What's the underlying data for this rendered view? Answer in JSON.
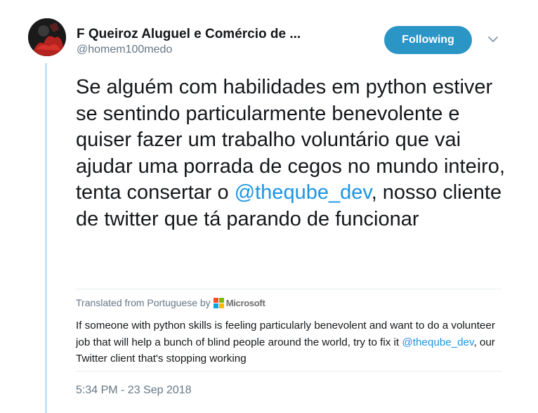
{
  "author": {
    "name": "F Queiroz Aluguel e Comércio de ...",
    "handle": "@homem100medo"
  },
  "follow_button": {
    "label": "Following"
  },
  "tweet": {
    "text_before": "Se alguém com habilidades em python estiver se sentindo particularmente benevolente e quiser fazer um trabalho voluntário que vai ajudar uma porrada de cegos no mundo inteiro, tenta consertar o ",
    "mention": "@theqube_dev",
    "text_after": ", nosso cliente de twitter que tá parando de funcionar"
  },
  "translation": {
    "label": "Translated from Portuguese by",
    "provider": "Microsoft",
    "text_before": "If someone with python skills is feeling particularly benevolent and want to do a volunteer job that will help a bunch of blind people around the world, try to fix it ",
    "mention": "@theqube_dev",
    "text_after": ", our Twitter client that's stopping working"
  },
  "timestamp": "5:34 PM - 23 Sep 2018",
  "colors": {
    "accent": "#1b95e0",
    "follow_button_bg": "#2b95c6",
    "secondary_text": "#657786",
    "thread_line": "#c4e4f5"
  },
  "icons": [
    "chevron-down-icon",
    "microsoft-logo-icon"
  ]
}
